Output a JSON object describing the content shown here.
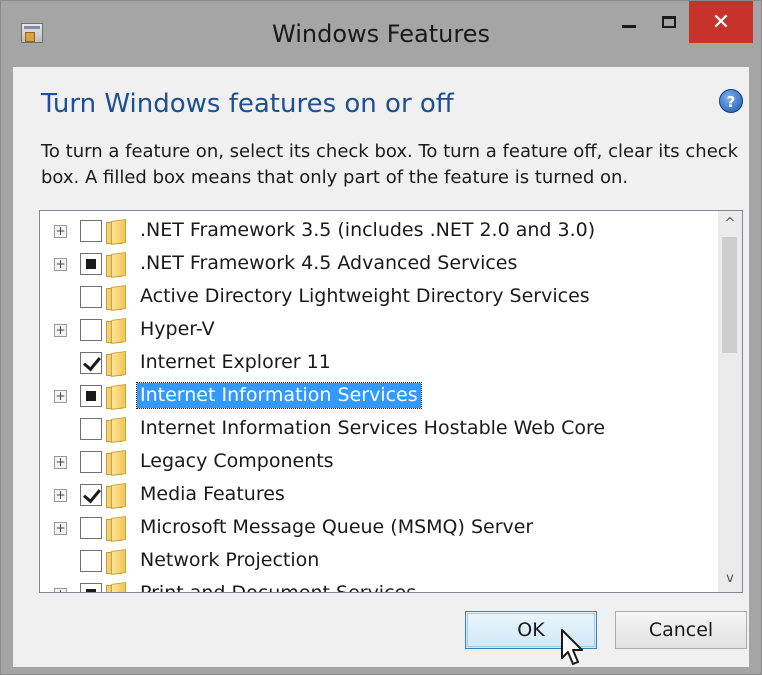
{
  "window": {
    "title": "Windows Features",
    "close_glyph": "✕",
    "icons": [
      "windows-features-app-icon",
      "minimize-icon",
      "maximize-icon",
      "close-icon"
    ]
  },
  "header": {
    "heading": "Turn Windows features on or off",
    "help_glyph": "?",
    "description": "To turn a feature on, select its check box. To turn a feature off, clear its check box. A filled box means that only part of the feature is turned on."
  },
  "features": [
    {
      "label": ".NET Framework 3.5 (includes .NET 2.0 and 3.0)",
      "expandable": true,
      "state": "unchecked",
      "selected": false
    },
    {
      "label": ".NET Framework 4.5 Advanced Services",
      "expandable": true,
      "state": "partial",
      "selected": false
    },
    {
      "label": "Active Directory Lightweight Directory Services",
      "expandable": false,
      "state": "unchecked",
      "selected": false
    },
    {
      "label": "Hyper-V",
      "expandable": true,
      "state": "unchecked",
      "selected": false
    },
    {
      "label": "Internet Explorer 11",
      "expandable": false,
      "state": "checked",
      "selected": false
    },
    {
      "label": "Internet Information Services",
      "expandable": true,
      "state": "partial",
      "selected": true
    },
    {
      "label": "Internet Information Services Hostable Web Core",
      "expandable": false,
      "state": "unchecked",
      "selected": false
    },
    {
      "label": "Legacy Components",
      "expandable": true,
      "state": "unchecked",
      "selected": false
    },
    {
      "label": "Media Features",
      "expandable": true,
      "state": "checked",
      "selected": false
    },
    {
      "label": "Microsoft Message Queue (MSMQ) Server",
      "expandable": true,
      "state": "unchecked",
      "selected": false
    },
    {
      "label": "Network Projection",
      "expandable": false,
      "state": "unchecked",
      "selected": false
    },
    {
      "label": "Print and Document Services",
      "expandable": true,
      "state": "partial",
      "selected": false
    }
  ],
  "scroll": {
    "up_glyph": "^",
    "down_glyph": "v"
  },
  "buttons": {
    "ok": "OK",
    "cancel": "Cancel"
  },
  "colors": {
    "heading": "#1d4f91",
    "selection": "#3399ff",
    "close": "#c7322b"
  }
}
